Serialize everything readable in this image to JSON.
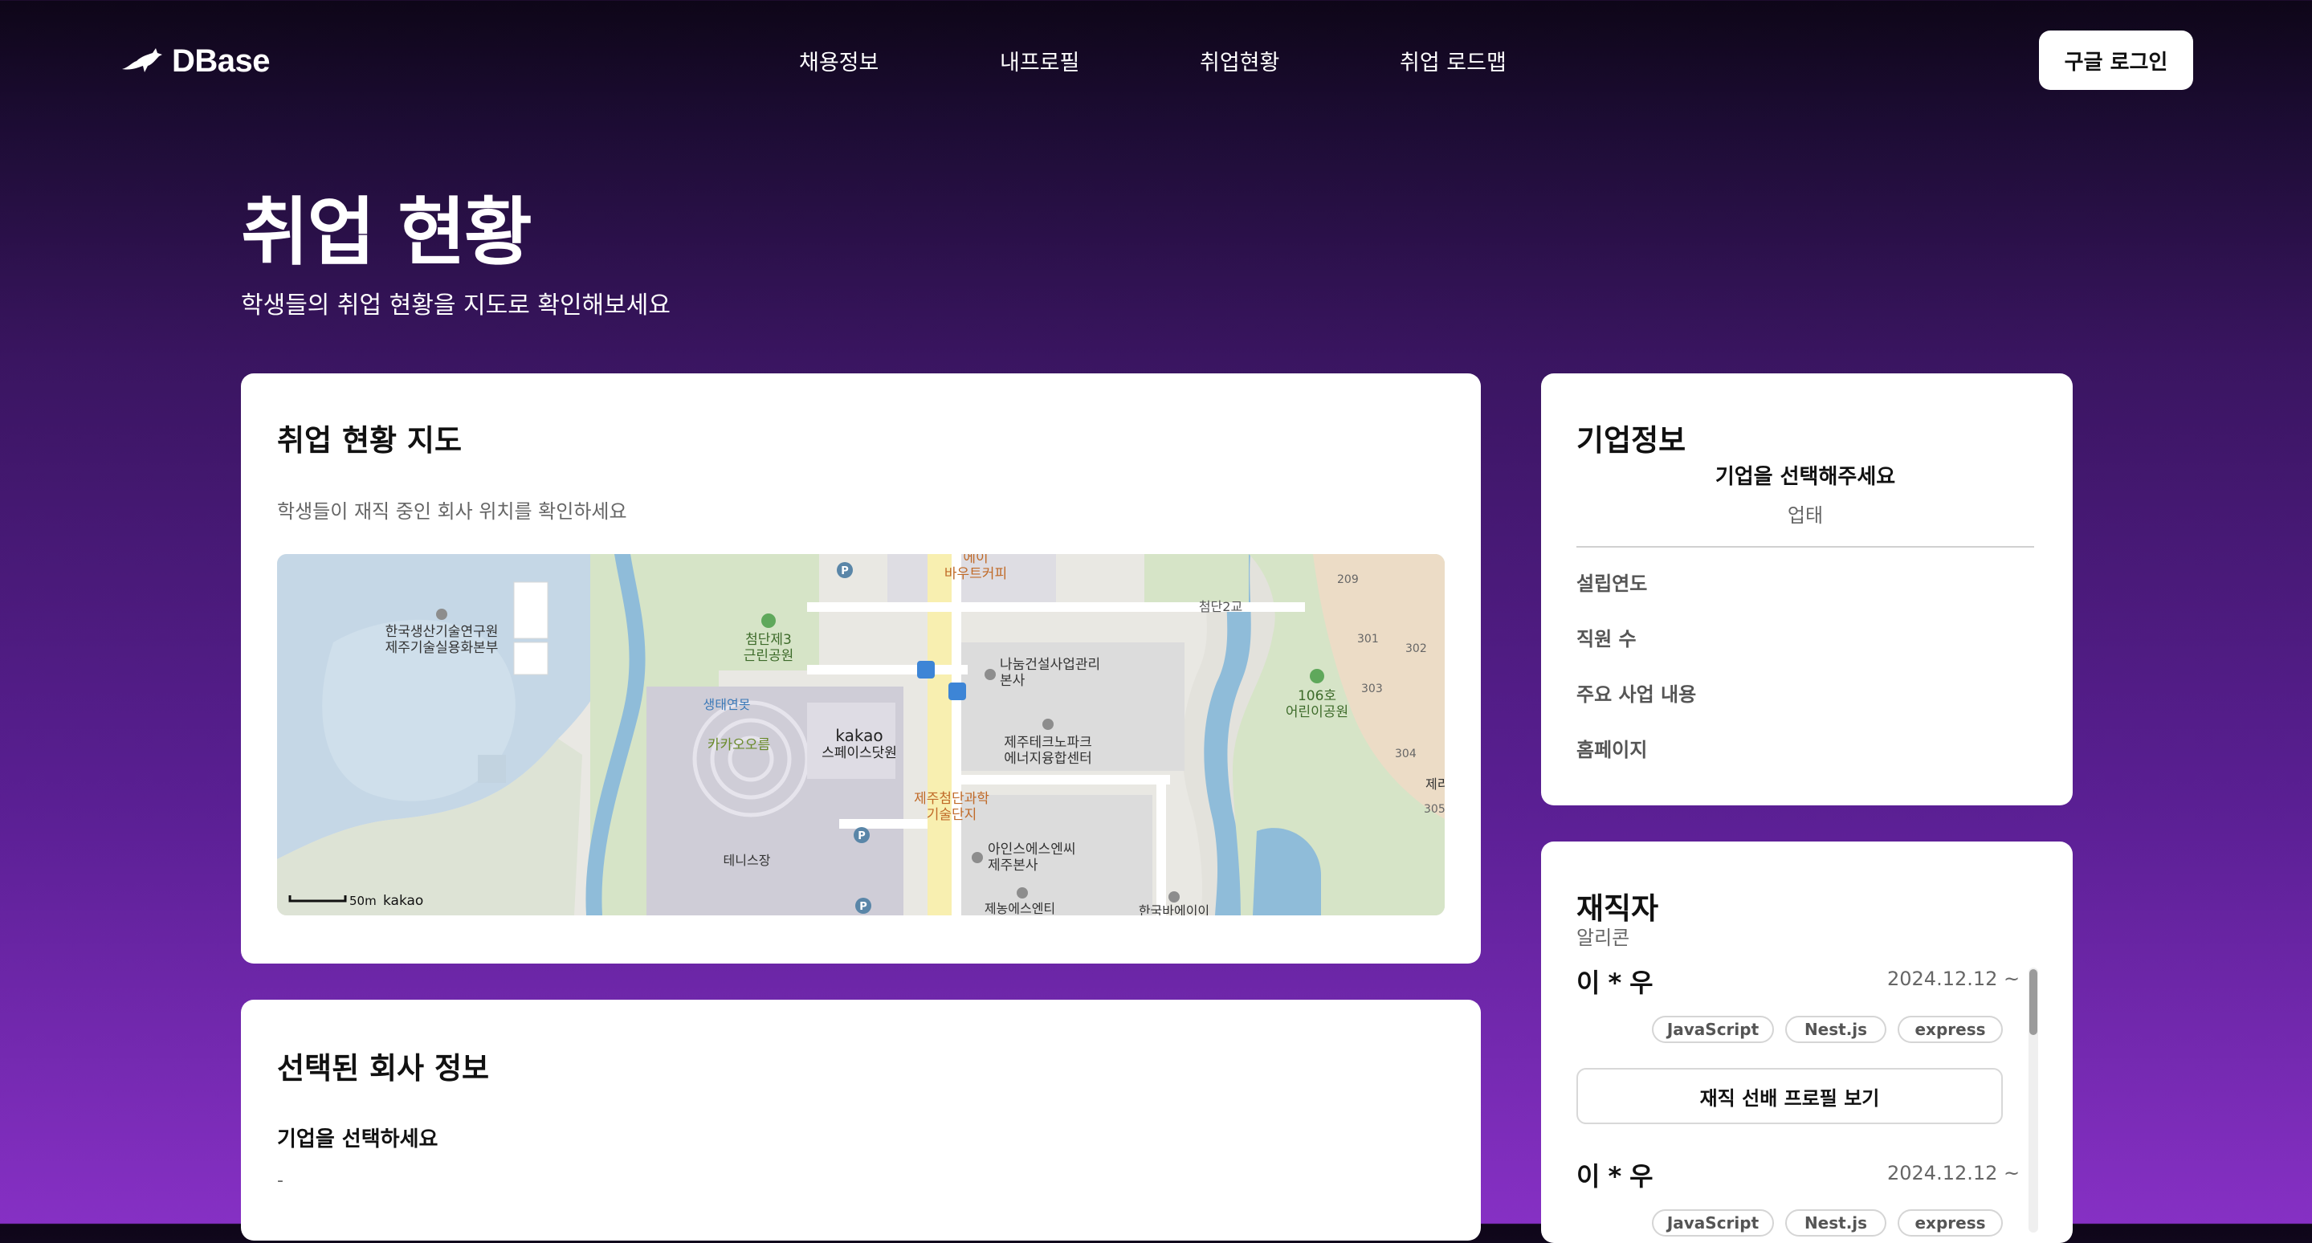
{
  "header": {
    "logo_text": "DBase",
    "nav": [
      "채용정보",
      "내프로필",
      "취업현황",
      "취업 로드맵"
    ],
    "login_label": "구글 로그인"
  },
  "page": {
    "title": "취업 현황",
    "subtitle": "학생들의 취업 현황을 지도로 확인해보세요"
  },
  "map_card": {
    "title": "취업 현황 지도",
    "description": "학생들이 재직 중인 회사 위치를 확인하세요",
    "map_labels": {
      "place1": "한국생산기술연구원",
      "place1b": "제주기술실용화본부",
      "park1": "첨단제3",
      "park1b": "근린공원",
      "building1": "나눔건설사업관리",
      "building1b": "본사",
      "cafe": "에이",
      "cafe2": "바우트커피",
      "bridge": "첨단2교",
      "building2": "제주테크노파크",
      "building2b": "에너지융합센터",
      "kakao": "kakao",
      "kakao2": "스페이스닷원",
      "saengtae": "생태연못",
      "kakaooreum": "카카오오름",
      "complex": "제주첨단과학",
      "complex2": "기술단지",
      "tennis": "테니스장",
      "aincs": "아인스에스엔씨",
      "aincs2": "제주본사",
      "park2": "106호",
      "park2b": "어린이공원",
      "bottom1": "제농에스엔티",
      "bottom2": "한국바에이이",
      "num209": "209",
      "num301": "301",
      "num302": "302",
      "num303": "303",
      "num304": "304",
      "num305": "305",
      "jeju": "제리",
      "scale": "50m",
      "brand": "kakao"
    }
  },
  "selected_card": {
    "title": "선택된 회사 정보",
    "company_name": "기업을 선택하세요",
    "company_detail": "-"
  },
  "company_info": {
    "title": "기업정보",
    "select_prompt": "기업을 선택해주세요",
    "industry": "업태",
    "rows": [
      {
        "label": "설립연도",
        "value": "-"
      },
      {
        "label": "직원 수",
        "value": "-"
      },
      {
        "label": "주요 사업 내용",
        "value": "-"
      },
      {
        "label": "홈페이지",
        "value": "-"
      }
    ]
  },
  "employees": {
    "title": "재직자",
    "company": "알리콘",
    "profile_button": "재직 선배 프로필 보기",
    "list": [
      {
        "name": "이*우",
        "date": "2024.12.12 ~",
        "tags": [
          "JavaScript",
          "Nest.js",
          "express"
        ]
      },
      {
        "name": "이*우",
        "date": "2024.12.12 ~",
        "tags": [
          "JavaScript",
          "Nest.js",
          "express"
        ]
      }
    ]
  },
  "colors": {
    "accent_purple": "#5a1f93",
    "card_bg": "#ffffff"
  }
}
